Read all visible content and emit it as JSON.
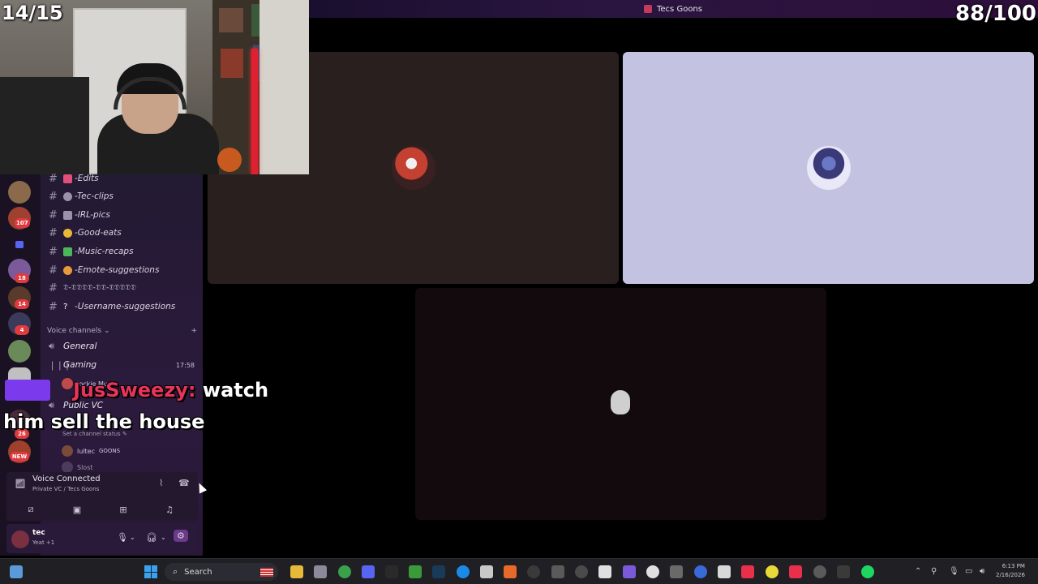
{
  "window": {
    "title": "Tecs Goons"
  },
  "overlay": {
    "counter_left": "14/15",
    "counter_right": "88/100"
  },
  "server_badges": [
    "107",
    "18",
    "14",
    "4",
    "26",
    "NEW"
  ],
  "text_channels": [
    {
      "label": "-Edits",
      "emoji_color": "#e0507a"
    },
    {
      "label": "-Tec-clips",
      "emoji_color": "#9a92a8"
    },
    {
      "label": "-IRL-pics",
      "emoji_color": "#9a92a8"
    },
    {
      "label": "-Good-eats",
      "emoji_color": "#e8b838"
    },
    {
      "label": "-Music-recaps",
      "emoji_color": "#4ab85a"
    },
    {
      "label": "-Emote-suggestions",
      "emoji_color": "#e89a3a"
    },
    {
      "label": "𝔇-𝔇𝔇𝔇𝔇-𝔇𝔇-𝔇𝔇𝔇𝔇𝔇",
      "emoji_color": ""
    },
    {
      "label": "-Username-suggestions",
      "emoji_color": "#ffffff"
    }
  ],
  "voice_section": {
    "header": "Voice channels",
    "add_icon": "+"
  },
  "voice_channels": [
    {
      "label": "General",
      "time": ""
    },
    {
      "label": "Gaming",
      "time": "17:58"
    },
    {
      "label": "Public VC",
      "time": ""
    }
  ],
  "gaming_member": "Jockie Music",
  "channel_status": "Set a channel status",
  "voice_members": [
    {
      "name": "lultec",
      "tag": "GOONS"
    },
    {
      "name": "Slost",
      "tag": ""
    }
  ],
  "chat": {
    "username": "JusSweezy:",
    "line1_rest": "watch",
    "line2": "him sell the house"
  },
  "voice_panel": {
    "title": "Voice Connected",
    "subtitle": "Private VC / Tecs Goons"
  },
  "user": {
    "name": "tec",
    "status": "Yeat +1"
  },
  "taskbar": {
    "search_label": "Search",
    "clock_time": "6:13 PM",
    "clock_date": "2/16/2026"
  },
  "colors": {
    "accent": "#5865f2",
    "badge": "#e03a3e",
    "chat_name": "#e8345a"
  }
}
